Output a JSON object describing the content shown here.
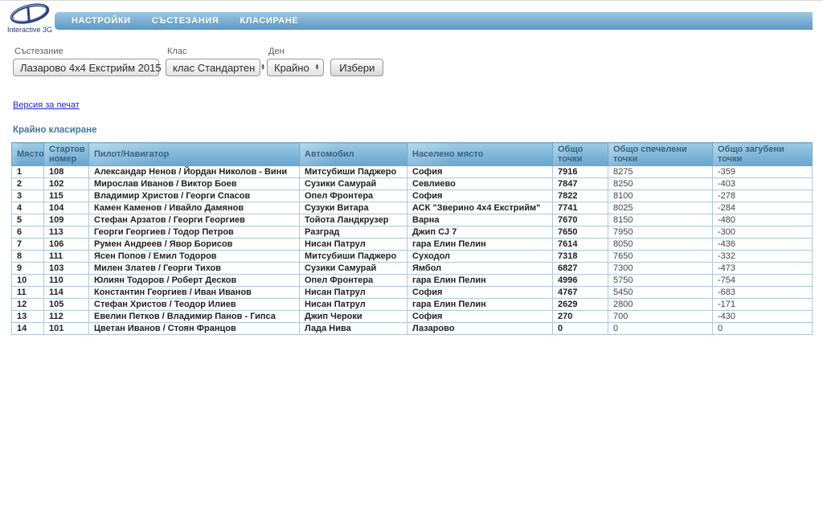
{
  "brand": {
    "name": "Interactive 3G"
  },
  "nav": {
    "items": [
      {
        "label": "НАСТРОЙКИ"
      },
      {
        "label": "СЪСТЕЗАНИЯ"
      },
      {
        "label": "КЛАСИРАНЕ"
      }
    ]
  },
  "filters": {
    "competition": {
      "label": "Състезание",
      "value": "Лазарово 4x4 Екстрийм 2015"
    },
    "class": {
      "label": "Клас",
      "value": "клас Стандартен"
    },
    "day": {
      "label": "Ден",
      "value": "Крайно"
    },
    "submit_label": "Избери"
  },
  "links": {
    "print_version": "Версия за печат"
  },
  "page": {
    "title": "Крайно класиране"
  },
  "table": {
    "headers": [
      "Място",
      "Стартов номер",
      "Пилот/Навигатор",
      "Автомобил",
      "Населено място",
      "Общо точки",
      "Общо спечелени точки",
      "Общо загубени точки"
    ],
    "header_keys": [
      "place",
      "start-number",
      "pilot-navigator",
      "car",
      "city",
      "total-points",
      "points-won",
      "points-lost"
    ],
    "rows": [
      [
        "1",
        "108",
        "Александар Ненов / Йордан Николов - Вини",
        "Митсубиши Паджеро",
        "София",
        "7916",
        "8275",
        "-359"
      ],
      [
        "2",
        "102",
        "Мирослав Иванов / Виктор Боев",
        "Сузики Самурай",
        "Севлиево",
        "7847",
        "8250",
        "-403"
      ],
      [
        "3",
        "115",
        "Владимир Христов / Георги Спасов",
        "Опел Фронтера",
        "София",
        "7822",
        "8100",
        "-278"
      ],
      [
        "4",
        "104",
        "Камен Каменов / Ивайло Дамянов",
        "Сузуки Витара",
        "АСК \"Зверино 4x4 Екстрийм\"",
        "7741",
        "8025",
        "-284"
      ],
      [
        "5",
        "109",
        "Стефан Арзатов / Георги Георгиев",
        "Тойота Ландкрузер",
        "Варна",
        "7670",
        "8150",
        "-480"
      ],
      [
        "6",
        "113",
        "Георги Георгиев / Тодор Петров",
        "Разград",
        "Джип CJ 7",
        "7650",
        "7950",
        "-300"
      ],
      [
        "7",
        "106",
        "Румен Андреев / Явор Борисов",
        "Нисан Патрул",
        "гара Елин Пелин",
        "7614",
        "8050",
        "-436"
      ],
      [
        "8",
        "111",
        "Ясен Попов / Емил Тодоров",
        "Митсубиши Паджеро",
        "Суходол",
        "7318",
        "7650",
        "-332"
      ],
      [
        "9",
        "103",
        "Милен Златев / Георги Тихов",
        "Сузики Самурай",
        "Ямбол",
        "6827",
        "7300",
        "-473"
      ],
      [
        "10",
        "110",
        "Юлиян Тодоров / Роберт Десков",
        "Опел Фронтера",
        "гара Елин Пелин",
        "4996",
        "5750",
        "-754"
      ],
      [
        "11",
        "114",
        "Константин Георгиев / Иван Иванов",
        "Нисан Патрул",
        "София",
        "4767",
        "5450",
        "-683"
      ],
      [
        "12",
        "105",
        "Стефан Христов / Теодор Илиев",
        "Нисан Патрул",
        "гара Елин Пелин",
        "2629",
        "2800",
        "-171"
      ],
      [
        "13",
        "112",
        "Евелин Петков / Владимир Панов - Гипса",
        "Джип Чероки",
        "София",
        "270",
        "700",
        "-430"
      ],
      [
        "14",
        "101",
        "Цветан Иванов / Стоян Францов",
        "Лада Нива",
        "Лазарово",
        "0",
        "0",
        "0"
      ]
    ]
  },
  "colors": {
    "nav-grad-top": "#9cc6e2",
    "nav-grad-bottom": "#5f9cc7",
    "th-grad-top": "#9ccae6",
    "th-grad-bottom": "#66a4ce",
    "th-text": "#3a6480",
    "border-blue": "#a9cadf",
    "th-border": "#74aacf",
    "link-blue": "#2323d6",
    "title-blue": "#47759e",
    "brand-navy": "#223b6e"
  }
}
